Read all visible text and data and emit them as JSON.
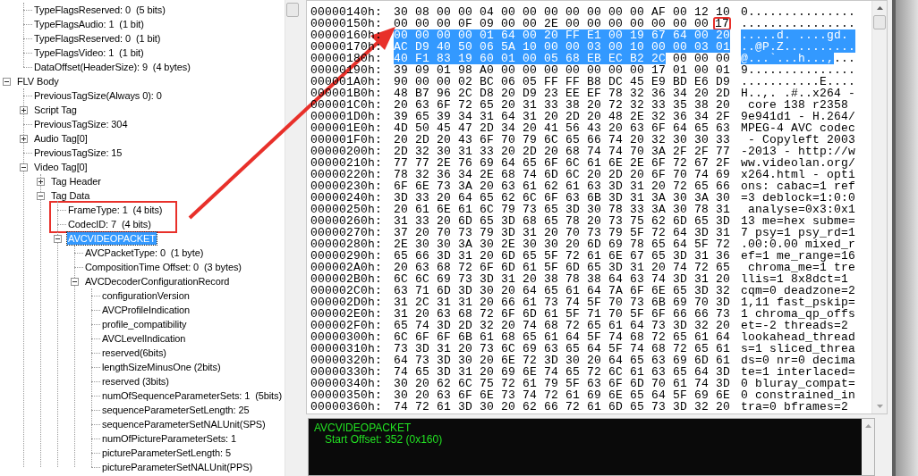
{
  "tree": [
    {
      "children": [
        {
          "label": "TypeFlagsReserved: 0  (5 bits)",
          "selected": false
        },
        {
          "label": "TypeFlagsAudio: 1  (1 bit)",
          "selected": false
        },
        {
          "label": "TypeFlagsReserved: 0  (1 bit)",
          "selected": false
        },
        {
          "label": "TypeFlagsVideo: 1  (1 bit)",
          "selected": false
        },
        {
          "label": "DataOffset(HeaderSize): 9  (4 bytes)",
          "selected": false
        }
      ]
    },
    {
      "label": "FLV Body",
      "selected": false,
      "expanded": true,
      "children": [
        {
          "label": "PreviousTagSize(Always 0): 0",
          "selected": false
        },
        {
          "label": "Script Tag",
          "selected": false,
          "expanded": false
        },
        {
          "label": "PreviousTagSize: 304",
          "selected": false
        },
        {
          "label": "Audio Tag[0]",
          "selected": false,
          "expanded": false
        },
        {
          "label": "PreviousTagSize: 15",
          "selected": false
        },
        {
          "label": "Video Tag[0]",
          "selected": false,
          "expanded": true,
          "children": [
            {
              "label": "Tag Header",
              "selected": false,
              "expanded": false
            },
            {
              "label": "Tag Data",
              "selected": false,
              "expanded": true,
              "children": [
                {
                  "label": "FrameType: 1  (4 bits)",
                  "selected": false,
                  "boxed": true
                },
                {
                  "label": "CodecID: 7  (4 bits)",
                  "selected": false,
                  "boxed": true
                },
                {
                  "label": "AVCVIDEOPACKET",
                  "selected": true,
                  "expanded": true,
                  "children": [
                    {
                      "label": "AVCPacketType: 0  (1 byte)",
                      "selected": false
                    },
                    {
                      "label": "CompositionTime Offset: 0  (3 bytes)",
                      "selected": false
                    },
                    {
                      "label": "AVCDecoderConfigurationRecord",
                      "selected": false,
                      "expanded": true,
                      "children": [
                        {
                          "label": "configurationVersion",
                          "selected": false
                        },
                        {
                          "label": "AVCProfileIndication",
                          "selected": false
                        },
                        {
                          "label": "profile_compatibility",
                          "selected": false
                        },
                        {
                          "label": "AVCLevelIndication",
                          "selected": false
                        },
                        {
                          "label": "reserved(6bits)",
                          "selected": false
                        },
                        {
                          "label": "lengthSizeMinusOne (2bits)",
                          "selected": false
                        },
                        {
                          "label": "reserved (3bits)",
                          "selected": false
                        },
                        {
                          "label": "numOfSequenceParameterSets: 1  (5bits)",
                          "selected": false
                        },
                        {
                          "label": "sequenceParameterSetLength: 25",
                          "selected": false
                        },
                        {
                          "label": "sequenceParameterSetNALUnit(SPS)",
                          "selected": false
                        },
                        {
                          "label": "numOfPictureParameterSets: 1",
                          "selected": false
                        },
                        {
                          "label": "pictureParameterSetLength: 5",
                          "selected": false
                        },
                        {
                          "label": "pictureParameterSetNALUnit(PPS)",
                          "selected": false
                        }
                      ]
                    }
                  ]
                }
              ]
            }
          ]
        }
      ]
    }
  ],
  "hex": {
    "rows": [
      {
        "address": "00000140h:",
        "bytes": [
          "30",
          "08",
          "00",
          "00",
          "04",
          "00",
          "00",
          "00",
          "00",
          "00",
          "00",
          "00",
          "AF",
          "00",
          "12",
          "10"
        ],
        "ascii": "0..............."
      },
      {
        "address": "00000150h:",
        "bytes": [
          "00",
          "00",
          "00",
          "0F",
          "09",
          "00",
          "00",
          "2E",
          "00",
          "00",
          "00",
          "00",
          "00",
          "00",
          "00"
        ],
        "boxed_bytes": [
          "17"
        ],
        "ascii": "................"
      },
      {
        "address": "00000160h:",
        "selected_bytes": [
          "00",
          "00",
          "00",
          "00",
          "01",
          "64",
          "00",
          "20",
          "FF",
          "E1",
          "00",
          "19",
          "67",
          "64",
          "00",
          "20"
        ],
        "selected_ascii": ".....d. ....gd. "
      },
      {
        "address": "00000170h:",
        "selected_bytes": [
          "AC",
          "D9",
          "40",
          "50",
          "06",
          "5A",
          "10",
          "00",
          "00",
          "03",
          "00",
          "10",
          "00",
          "00",
          "03",
          "01"
        ],
        "selected_ascii": "..@P.Z.........."
      },
      {
        "address": "00000180h:",
        "selected_bytes": [
          "40",
          "F1",
          "83",
          "19",
          "60",
          "01",
          "00",
          "05",
          "68",
          "EB",
          "EC",
          "B2",
          "2C"
        ],
        "bytes": [
          "00",
          "00",
          "00"
        ],
        "selected_ascii": "@...`...h...,",
        "ascii": "..."
      },
      {
        "address": "00000190h:",
        "bytes": [
          "39",
          "09",
          "01",
          "98",
          "A0",
          "00",
          "00",
          "00",
          "00",
          "00",
          "00",
          "00",
          "17",
          "01",
          "00",
          "01"
        ],
        "ascii": "9..............."
      },
      {
        "address": "000001A0h:",
        "bytes": [
          "90",
          "00",
          "00",
          "02",
          "BC",
          "06",
          "05",
          "FF",
          "FF",
          "B8",
          "DC",
          "45",
          "E9",
          "BD",
          "E6",
          "D9"
        ],
        "ascii": "...........E...."
      },
      {
        "address": "000001B0h:",
        "bytes": [
          "48",
          "B7",
          "96",
          "2C",
          "D8",
          "20",
          "D9",
          "23",
          "EE",
          "EF",
          "78",
          "32",
          "36",
          "34",
          "20",
          "2D"
        ],
        "ascii": "H..,. .#..x264 -"
      },
      {
        "address": "000001C0h:",
        "bytes": [
          "20",
          "63",
          "6F",
          "72",
          "65",
          "20",
          "31",
          "33",
          "38",
          "20",
          "72",
          "32",
          "33",
          "35",
          "38",
          "20"
        ],
        "ascii": " core 138 r2358 "
      },
      {
        "address": "000001D0h:",
        "bytes": [
          "39",
          "65",
          "39",
          "34",
          "31",
          "64",
          "31",
          "20",
          "2D",
          "20",
          "48",
          "2E",
          "32",
          "36",
          "34",
          "2F"
        ],
        "ascii": "9e941d1 - H.264/"
      },
      {
        "address": "000001E0h:",
        "bytes": [
          "4D",
          "50",
          "45",
          "47",
          "2D",
          "34",
          "20",
          "41",
          "56",
          "43",
          "20",
          "63",
          "6F",
          "64",
          "65",
          "63"
        ],
        "ascii": "MPEG-4 AVC codec"
      },
      {
        "address": "000001F0h:",
        "bytes": [
          "20",
          "2D",
          "20",
          "43",
          "6F",
          "70",
          "79",
          "6C",
          "65",
          "66",
          "74",
          "20",
          "32",
          "30",
          "30",
          "33"
        ],
        "ascii": " - Copyleft 2003"
      },
      {
        "address": "00000200h:",
        "bytes": [
          "2D",
          "32",
          "30",
          "31",
          "33",
          "20",
          "2D",
          "20",
          "68",
          "74",
          "74",
          "70",
          "3A",
          "2F",
          "2F",
          "77"
        ],
        "ascii": "-2013 - http://w"
      },
      {
        "address": "00000210h:",
        "bytes": [
          "77",
          "77",
          "2E",
          "76",
          "69",
          "64",
          "65",
          "6F",
          "6C",
          "61",
          "6E",
          "2E",
          "6F",
          "72",
          "67",
          "2F"
        ],
        "ascii": "ww.videolan.org/"
      },
      {
        "address": "00000220h:",
        "bytes": [
          "78",
          "32",
          "36",
          "34",
          "2E",
          "68",
          "74",
          "6D",
          "6C",
          "20",
          "2D",
          "20",
          "6F",
          "70",
          "74",
          "69"
        ],
        "ascii": "x264.html - opti"
      },
      {
        "address": "00000230h:",
        "bytes": [
          "6F",
          "6E",
          "73",
          "3A",
          "20",
          "63",
          "61",
          "62",
          "61",
          "63",
          "3D",
          "31",
          "20",
          "72",
          "65",
          "66"
        ],
        "ascii": "ons: cabac=1 ref"
      },
      {
        "address": "00000240h:",
        "bytes": [
          "3D",
          "33",
          "20",
          "64",
          "65",
          "62",
          "6C",
          "6F",
          "63",
          "6B",
          "3D",
          "31",
          "3A",
          "30",
          "3A",
          "30"
        ],
        "ascii": "=3 deblock=1:0:0"
      },
      {
        "address": "00000250h:",
        "bytes": [
          "20",
          "61",
          "6E",
          "61",
          "6C",
          "79",
          "73",
          "65",
          "3D",
          "30",
          "78",
          "33",
          "3A",
          "30",
          "78",
          "31"
        ],
        "ascii": " analyse=0x3:0x1"
      },
      {
        "address": "00000260h:",
        "bytes": [
          "31",
          "33",
          "20",
          "6D",
          "65",
          "3D",
          "68",
          "65",
          "78",
          "20",
          "73",
          "75",
          "62",
          "6D",
          "65",
          "3D"
        ],
        "ascii": "13 me=hex subme="
      },
      {
        "address": "00000270h:",
        "bytes": [
          "37",
          "20",
          "70",
          "73",
          "79",
          "3D",
          "31",
          "20",
          "70",
          "73",
          "79",
          "5F",
          "72",
          "64",
          "3D",
          "31"
        ],
        "ascii": "7 psy=1 psy_rd=1"
      },
      {
        "address": "00000280h:",
        "bytes": [
          "2E",
          "30",
          "30",
          "3A",
          "30",
          "2E",
          "30",
          "30",
          "20",
          "6D",
          "69",
          "78",
          "65",
          "64",
          "5F",
          "72"
        ],
        "ascii": ".00:0.00 mixed_r"
      },
      {
        "address": "00000290h:",
        "bytes": [
          "65",
          "66",
          "3D",
          "31",
          "20",
          "6D",
          "65",
          "5F",
          "72",
          "61",
          "6E",
          "67",
          "65",
          "3D",
          "31",
          "36"
        ],
        "ascii": "ef=1 me_range=16"
      },
      {
        "address": "000002A0h:",
        "bytes": [
          "20",
          "63",
          "68",
          "72",
          "6F",
          "6D",
          "61",
          "5F",
          "6D",
          "65",
          "3D",
          "31",
          "20",
          "74",
          "72",
          "65"
        ],
        "ascii": " chroma_me=1 tre"
      },
      {
        "address": "000002B0h:",
        "bytes": [
          "6C",
          "6C",
          "69",
          "73",
          "3D",
          "31",
          "20",
          "38",
          "78",
          "38",
          "64",
          "63",
          "74",
          "3D",
          "31",
          "20"
        ],
        "ascii": "llis=1 8x8dct=1 "
      },
      {
        "address": "000002C0h:",
        "bytes": [
          "63",
          "71",
          "6D",
          "3D",
          "30",
          "20",
          "64",
          "65",
          "61",
          "64",
          "7A",
          "6F",
          "6E",
          "65",
          "3D",
          "32"
        ],
        "ascii": "cqm=0 deadzone=2"
      },
      {
        "address": "000002D0h:",
        "bytes": [
          "31",
          "2C",
          "31",
          "31",
          "20",
          "66",
          "61",
          "73",
          "74",
          "5F",
          "70",
          "73",
          "6B",
          "69",
          "70",
          "3D"
        ],
        "ascii": "1,11 fast_pskip="
      },
      {
        "address": "000002E0h:",
        "bytes": [
          "31",
          "20",
          "63",
          "68",
          "72",
          "6F",
          "6D",
          "61",
          "5F",
          "71",
          "70",
          "5F",
          "6F",
          "66",
          "66",
          "73"
        ],
        "ascii": "1 chroma_qp_offs"
      },
      {
        "address": "000002F0h:",
        "bytes": [
          "65",
          "74",
          "3D",
          "2D",
          "32",
          "20",
          "74",
          "68",
          "72",
          "65",
          "61",
          "64",
          "73",
          "3D",
          "32",
          "20"
        ],
        "ascii": "et=-2 threads=2 "
      },
      {
        "address": "00000300h:",
        "bytes": [
          "6C",
          "6F",
          "6F",
          "6B",
          "61",
          "68",
          "65",
          "61",
          "64",
          "5F",
          "74",
          "68",
          "72",
          "65",
          "61",
          "64"
        ],
        "ascii": "lookahead_thread"
      },
      {
        "address": "00000310h:",
        "bytes": [
          "73",
          "3D",
          "31",
          "20",
          "73",
          "6C",
          "69",
          "63",
          "65",
          "64",
          "5F",
          "74",
          "68",
          "72",
          "65",
          "61"
        ],
        "ascii": "s=1 sliced_threa"
      },
      {
        "address": "00000320h:",
        "bytes": [
          "64",
          "73",
          "3D",
          "30",
          "20",
          "6E",
          "72",
          "3D",
          "30",
          "20",
          "64",
          "65",
          "63",
          "69",
          "6D",
          "61"
        ],
        "ascii": "ds=0 nr=0 decima"
      },
      {
        "address": "00000330h:",
        "bytes": [
          "74",
          "65",
          "3D",
          "31",
          "20",
          "69",
          "6E",
          "74",
          "65",
          "72",
          "6C",
          "61",
          "63",
          "65",
          "64",
          "3D"
        ],
        "ascii": "te=1 interlaced="
      },
      {
        "address": "00000340h:",
        "bytes": [
          "30",
          "20",
          "62",
          "6C",
          "75",
          "72",
          "61",
          "79",
          "5F",
          "63",
          "6F",
          "6D",
          "70",
          "61",
          "74",
          "3D"
        ],
        "ascii": "0 bluray_compat="
      },
      {
        "address": "00000350h:",
        "bytes": [
          "30",
          "20",
          "63",
          "6F",
          "6E",
          "73",
          "74",
          "72",
          "61",
          "69",
          "6E",
          "65",
          "64",
          "5F",
          "69",
          "6E"
        ],
        "ascii": "0 constrained_in"
      },
      {
        "address": "00000360h:",
        "bytes": [
          "74",
          "72",
          "61",
          "3D",
          "30",
          "20",
          "62",
          "66",
          "72",
          "61",
          "6D",
          "65",
          "73",
          "3D",
          "32",
          "20"
        ],
        "ascii": "tra=0 bframes=2 "
      }
    ]
  },
  "console": {
    "lines": [
      {
        "kind": "title",
        "text": "AVCVIDEOPACKET"
      },
      {
        "kind": "detail",
        "text": "Start Offset: 352 (0x160)"
      }
    ]
  }
}
